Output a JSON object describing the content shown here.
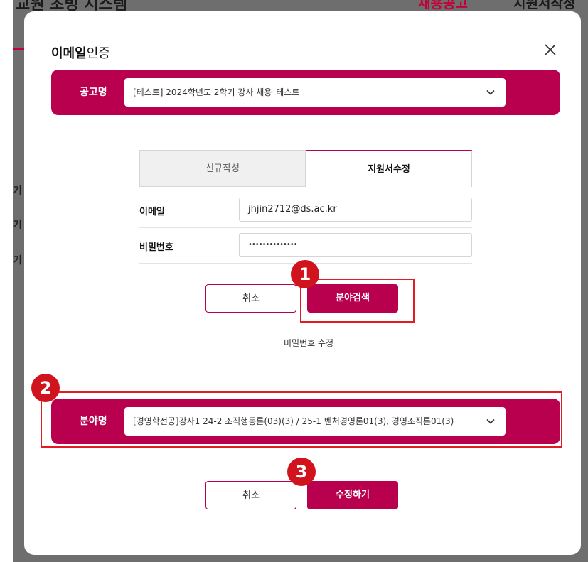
{
  "background": {
    "site_title": "교원 초빙 시스템",
    "nav": [
      "채용공고",
      "지원서작성"
    ],
    "row_markers": [
      "기",
      "기",
      "기"
    ]
  },
  "modal": {
    "title_bold": "이메일",
    "title_rest": "인증"
  },
  "notice_bar": {
    "label": "공고명",
    "selected": "[테스트] 2024학년도 2학기 강사 채용_테스트"
  },
  "tabs": [
    {
      "label": "신규작성",
      "active": false
    },
    {
      "label": "지원서수정",
      "active": true
    }
  ],
  "form": {
    "email_label": "이메일",
    "email_value": "jhjin2712@ds.ac.kr",
    "password_label": "비밀번호",
    "password_value": "••••••••••••••"
  },
  "buttons_top": {
    "cancel": "취소",
    "search": "분야검색"
  },
  "password_edit_link": "비밀번호 수정",
  "field_bar": {
    "label": "분야명",
    "selected": "[경영학전공]강사1 24-2 조직행동론(03)(3) / 25-1 벤처경영론01(3), 경영조직론01(3)"
  },
  "buttons_bottom": {
    "cancel": "취소",
    "submit": "수정하기"
  },
  "annotations": [
    "1",
    "2",
    "3"
  ],
  "colors": {
    "brand": "#b8004e",
    "highlight": "#e31b23",
    "badge": "#d0131c",
    "overlay": "#6e6e6e"
  }
}
